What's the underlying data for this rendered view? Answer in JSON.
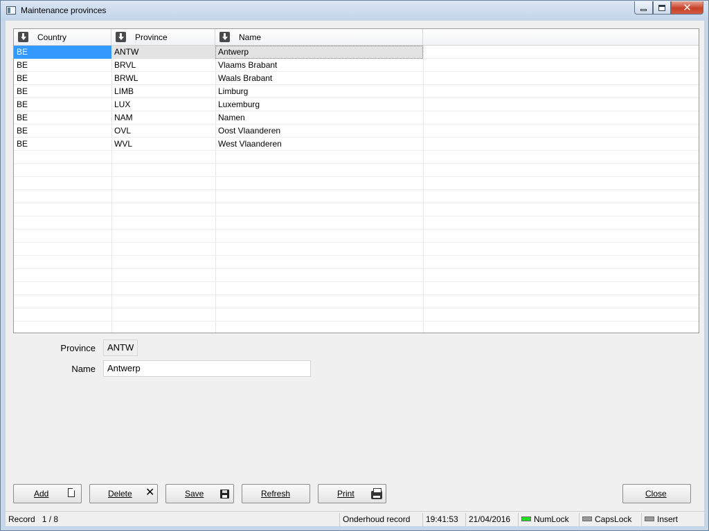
{
  "window": {
    "title": "Maintenance provinces",
    "controls": {
      "minimize": "minimize",
      "maximize": "maximize",
      "close": "✕"
    }
  },
  "grid": {
    "columns": [
      "Country",
      "Province",
      "Name"
    ],
    "rows": [
      {
        "country": "BE",
        "province": "ANTW",
        "name": "Antwerp",
        "selected": true
      },
      {
        "country": "BE",
        "province": "BRVL",
        "name": "Vlaams Brabant"
      },
      {
        "country": "BE",
        "province": "BRWL",
        "name": "Waals Brabant"
      },
      {
        "country": "BE",
        "province": "LIMB",
        "name": "Limburg"
      },
      {
        "country": "BE",
        "province": "LUX",
        "name": "Luxemburg"
      },
      {
        "country": "BE",
        "province": "NAM",
        "name": "Namen"
      },
      {
        "country": "BE",
        "province": "OVL",
        "name": "Oost Vlaanderen"
      },
      {
        "country": "BE",
        "province": "WVL",
        "name": "West Vlaanderen"
      }
    ]
  },
  "form": {
    "province_label": "Province",
    "province_value": "ANTW",
    "name_label": "Name",
    "name_value": "Antwerp"
  },
  "buttons": {
    "add": "Add",
    "delete": "Delete",
    "save": "Save",
    "refresh": "Refresh",
    "print": "Print",
    "close": "Close"
  },
  "icons": {
    "add": "new-page-icon",
    "delete": "x-icon",
    "save": "disk-icon",
    "print": "printer-icon",
    "sort": "sort-down-icon"
  },
  "status": {
    "record_label": "Record",
    "record_position": "1 / 8",
    "mode": "Onderhoud record",
    "time": "19:41:53",
    "date": "21/04/2016",
    "numlock": "NumLock",
    "capslock": "CapsLock",
    "insert": "Insert"
  },
  "colors": {
    "selection": "#3399ff",
    "numlock_on": "#22dd22",
    "indicator_off": "#9a9a9a"
  }
}
